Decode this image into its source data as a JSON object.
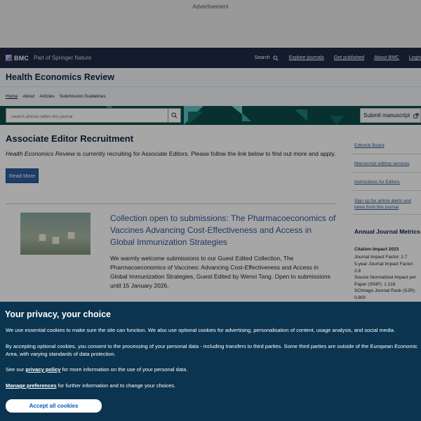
{
  "ad": {
    "label": "Advertisement"
  },
  "header": {
    "logo_text": "BMC",
    "logo_sub": "Part of Springer Nature",
    "search_label": "Search",
    "nav": [
      "Explore journals",
      "Get published",
      "About BMC",
      "Login"
    ]
  },
  "journal": {
    "title": "Health Economics Review",
    "subnav": [
      "Home",
      "About",
      "Articles",
      "Submission Guidelines"
    ]
  },
  "search": {
    "placeholder": "Search articles within this journal",
    "submit_label": "Submit manuscript"
  },
  "main": {
    "recruit_title": "Associate Editor Recruitment",
    "recruit_journal": "Health Economics Review",
    "recruit_text": " is currently recruiting for Associate Editors. Please follow the link below to find out more and apply.",
    "read_more": "Read More",
    "collection_title": "Collection open to submissions: The Pharmacoeconomics of Vaccines Advancing Cost-Effectiveness and Access in Global Immunization Strategies",
    "collection_text": "We warmly welcome submissions to our Guest Edited Collection, The Pharmacoeconomics of Vaccines: Advancing Cost-Effectiveness and Access in Global Immunization Strategies, Guest Edited by Wenxi Tang. Open to submissions until 15 January 2026."
  },
  "sidebar": {
    "links": [
      "Editorial Board",
      "Manuscript editing services",
      "Instructions for Editors",
      "Sign up for article alerts and news from this journal"
    ],
    "metrics_title": "Annual Journal Metrics",
    "citation_title": "Citation Impact 2023",
    "metrics": [
      "Journal Impact Factor: 2.7",
      "5-year Journal Impact Factor: 2.8",
      "Source Normalized Impact per Paper (SNIP): 1.218",
      "SCImago Journal Rank (SJR): 0.800"
    ]
  },
  "cookie": {
    "title": "Your privacy, your choice",
    "p1": "We use essential cookies to make sure the site can function. We also use optional cookies for advertising, personalisation of content, usage analysis, and social media.",
    "p2": "By accepting optional cookies, you consent to the processing of your personal data - including transfers to third parties. Some third parties are outside of the European Economic Area, with varying standards of data protection.",
    "p3_pre": "See our ",
    "p3_link": "privacy policy",
    "p3_post": " for more information on the use of your personal data.",
    "manage_link": "Manage preferences",
    "manage_post": " for further information and to change your choices.",
    "accept": "Accept all cookies"
  },
  "colors": {
    "header_bg": "#1f2a44",
    "banner_bg": "#0b4b48",
    "cookie_bg": "#0a344f",
    "link": "#2b5a96",
    "button": "#2d5fa0"
  }
}
